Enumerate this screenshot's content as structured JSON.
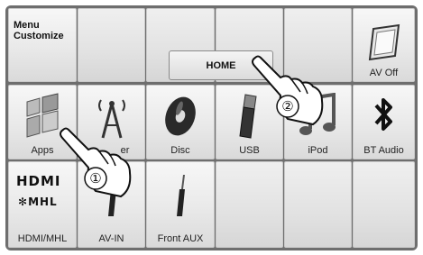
{
  "header": {
    "title": "Menu Customize"
  },
  "home_button": {
    "label": "HOME"
  },
  "tiles": {
    "av_off": "AV Off",
    "apps": "Apps",
    "tuner_partial": "er",
    "disc": "Disc",
    "usb": "USB",
    "ipod": "iPod",
    "bt_audio": "BT Audio",
    "hdmi_mhl": "HDMI/MHL",
    "av_in": "AV-IN",
    "front_aux": "Front AUX"
  },
  "logos": {
    "hdmi": "HDMI",
    "mhl": "MHL"
  },
  "callouts": {
    "step1": "①",
    "step2": "②"
  },
  "icons": {
    "av_off": "av-off-icon",
    "apps": "apps-icon",
    "tuner": "tuner-antenna-icon",
    "disc": "disc-icon",
    "usb": "usb-icon",
    "ipod": "ipod-music-icon",
    "bt_audio": "bluetooth-icon",
    "av_in": "av-in-plug-icon",
    "front_aux": "aux-plug-icon",
    "hand": "pointing-hand-icon"
  },
  "colors": {
    "frame": "#6e6e6e",
    "tile": "#ebebeb",
    "text": "#222222"
  }
}
